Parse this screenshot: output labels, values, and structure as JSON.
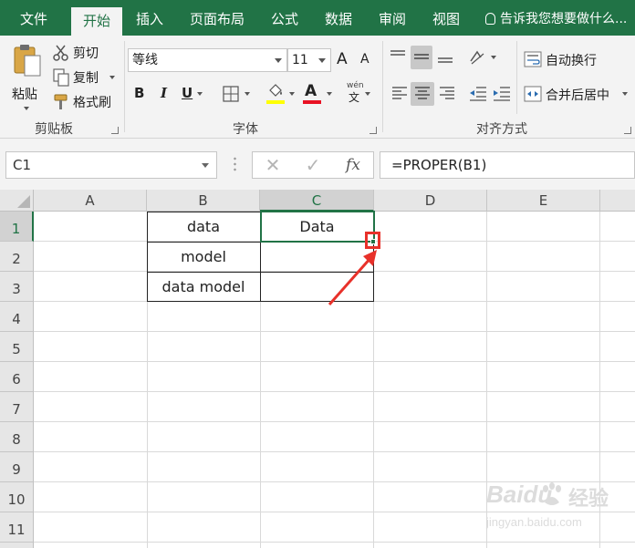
{
  "ribbon_tabs": [
    {
      "label": "文件",
      "active": false
    },
    {
      "label": "开始",
      "active": true
    },
    {
      "label": "插入",
      "active": false
    },
    {
      "label": "页面布局",
      "active": false
    },
    {
      "label": "公式",
      "active": false
    },
    {
      "label": "数据",
      "active": false
    },
    {
      "label": "审阅",
      "active": false
    },
    {
      "label": "视图",
      "active": false
    }
  ],
  "tell_me": "告诉我您想要做什么...",
  "clipboard": {
    "paste": "粘贴",
    "cut": "剪切",
    "copy": "复制",
    "format_painter": "格式刷",
    "group_label": "剪贴板"
  },
  "font": {
    "font_name": "等线",
    "font_size": "11",
    "grow_label": "A",
    "shrink_label": "A",
    "bold": "B",
    "italic": "I",
    "underline": "U",
    "font_color_label": "A",
    "phonetic_top": "wén",
    "phonetic_bottom": "文",
    "group_label": "字体",
    "highlight_color": "#ffff00",
    "font_color": "#e81123"
  },
  "alignment": {
    "wrap_text": "自动换行",
    "merge_center": "合并后居中",
    "group_label": "对齐方式"
  },
  "formula_bar": {
    "name_box": "C1",
    "cancel": "✕",
    "enter": "✓",
    "fx": "fx",
    "formula": "=PROPER(B1)"
  },
  "columns": [
    "A",
    "B",
    "C",
    "D",
    "E"
  ],
  "rows": [
    "1",
    "2",
    "3",
    "4",
    "5",
    "6",
    "7",
    "8",
    "9",
    "10",
    "11"
  ],
  "selected_column": "C",
  "selected_row": "1",
  "cells": {
    "B1": "data",
    "B2": "model",
    "B3": "data model",
    "C1": "Data"
  },
  "watermark": {
    "brand": "Baidu",
    "suffix": "经验",
    "url": "jingyan.baidu.com"
  },
  "colors": {
    "excel_green": "#217346",
    "annotation_red": "#e8312a"
  }
}
